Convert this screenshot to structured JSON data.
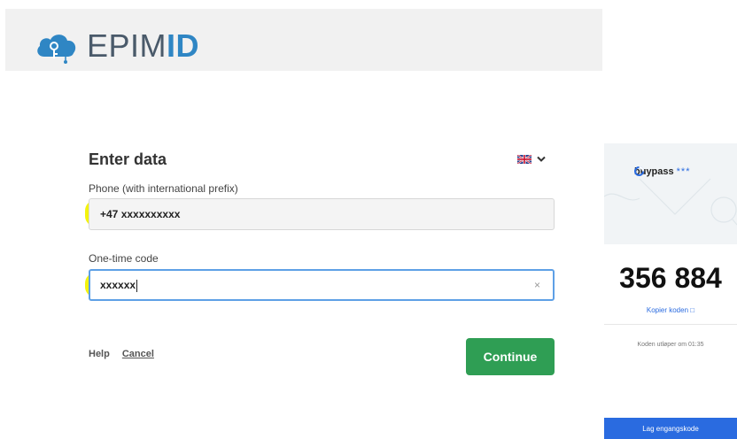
{
  "header": {
    "logo_prefix": "EPIM",
    "logo_bold": "ID"
  },
  "form": {
    "title": "Enter data",
    "language_icon": "uk-flag-icon",
    "phone_label": "Phone (with international prefix)",
    "phone_value": "+47 xxxxxxxxxx",
    "otp_label": "One-time code",
    "otp_value": "xxxxxx",
    "clear_symbol": "×"
  },
  "footer": {
    "help": "Help",
    "cancel": "Cancel",
    "continue": "Continue"
  },
  "phone_panel": {
    "brand": "buypass",
    "brand_stars": "***",
    "code": "356 884",
    "copy": "Kopier koden",
    "expire": "Koden utløper om 01:35",
    "new_code": "Lag engangskode"
  },
  "colors": {
    "continue_bg": "#2f9e54",
    "highlight": "#f2f200",
    "focus_border": "#5ea0e6",
    "buypass_blue": "#2a6be0"
  }
}
